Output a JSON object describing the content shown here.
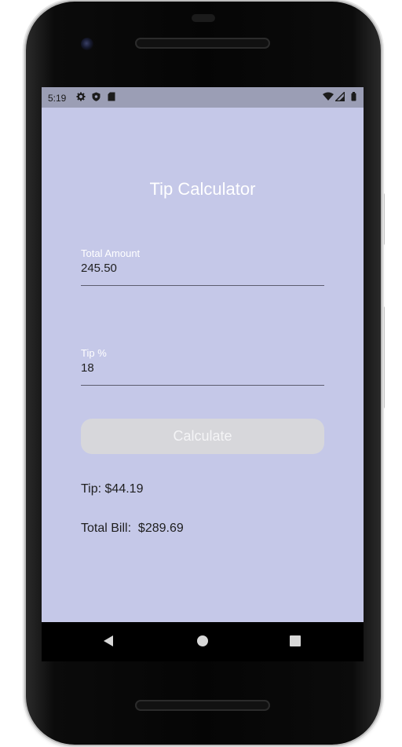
{
  "status_bar": {
    "time": "5:19",
    "left_icons": [
      "settings-icon",
      "shield-icon",
      "sd-card-icon"
    ],
    "right_icons": [
      "wifi-icon",
      "signal-icon",
      "battery-icon"
    ]
  },
  "app": {
    "title": "Tip Calculator",
    "total_amount": {
      "label": "Total Amount",
      "value": "245.50"
    },
    "tip_percent": {
      "label": "Tip %",
      "value": "18"
    },
    "calculate_label": "Calculate",
    "tip_result": "Tip: $44.19",
    "total_bill_result": "Total Bill:  $289.69"
  },
  "nav_bar": {
    "buttons": [
      "back-icon",
      "home-icon",
      "recents-icon"
    ]
  },
  "colors": {
    "screen_background": "#c5c8e8",
    "status_bar_background": "#9b9eb5",
    "button_background": "#d7d7db",
    "title_color": "#ffffff"
  }
}
